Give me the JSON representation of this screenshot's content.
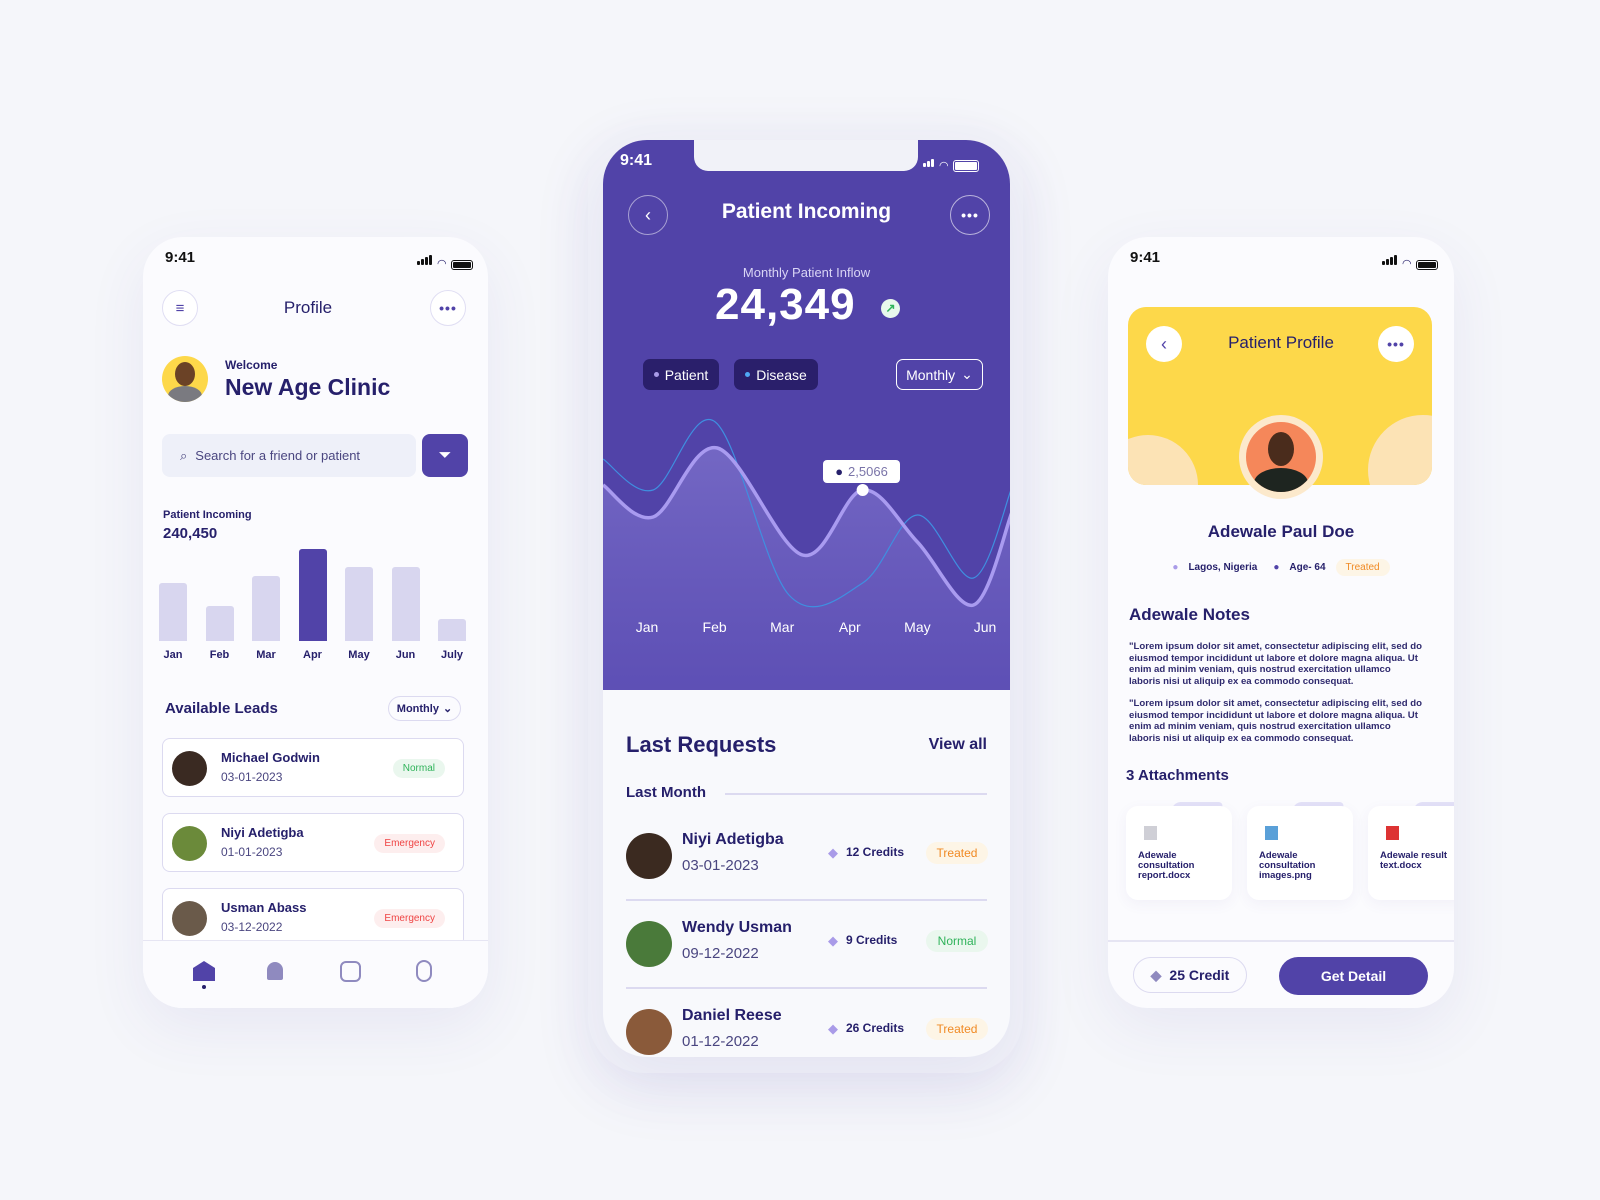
{
  "status_time": "9:41",
  "left": {
    "title": "Profile",
    "welcome": "Welcome",
    "clinic": "New Age Clinic",
    "search_placeholder": "Search for a friend or patient",
    "incoming_label": "Patient Incoming",
    "incoming_value": "240,450",
    "leads_title": "Available Leads",
    "leads_filter": "Monthly",
    "leads": [
      {
        "name": "Michael Godwin",
        "date": "03-01-2023",
        "status": "Normal"
      },
      {
        "name": "Niyi Adetigba",
        "date": "01-01-2023",
        "status": "Emergency"
      },
      {
        "name": "Usman Abass",
        "date": "03-12-2022",
        "status": "Emergency"
      }
    ],
    "nav": [
      "home-icon",
      "bell-icon",
      "sliders-icon",
      "user-icon"
    ]
  },
  "center": {
    "title": "Patient Incoming",
    "inflow_label": "Monthly Patient Inflow",
    "inflow_value": "24,349",
    "chip_patient": "Patient",
    "chip_disease": "Disease",
    "period": "Monthly",
    "tooltip": "2,5066",
    "requests_title": "Last Requests",
    "view_all": "View all",
    "group": "Last Month",
    "requests": [
      {
        "name": "Niyi Adetigba",
        "date": "03-01-2023",
        "credits": "12 Credits",
        "status": "Treated"
      },
      {
        "name": "Wendy Usman",
        "date": "09-12-2022",
        "credits": "9 Credits",
        "status": "Normal"
      },
      {
        "name": "Daniel Reese",
        "date": "01-12-2022",
        "credits": "26 Credits",
        "status": "Treated"
      }
    ]
  },
  "right": {
    "title": "Patient Profile",
    "name": "Adewale Paul Doe",
    "location": "Lagos, Nigeria",
    "age": "Age- 64",
    "status": "Treated",
    "notes_title": "Adewale Notes",
    "notes": [
      "\"Lorem ipsum dolor sit amet, consectetur adipiscing elit, sed do eiusmod tempor incididunt ut labore et dolore magna aliqua. Ut enim ad minim veniam, quis nostrud exercitation ullamco laboris nisi ut aliquip ex ea commodo consequat.",
      "\"Lorem ipsum dolor sit amet, consectetur adipiscing elit, sed do eiusmod tempor incididunt ut labore et dolore magna aliqua. Ut enim ad minim veniam, quis nostrud exercitation ullamco laboris nisi ut aliquip ex ea commodo consequat."
    ],
    "attachments_title": "3 Attachments",
    "attachments": [
      "Adewale consultation report.docx",
      "Adewale consultation images.png",
      "Adewale result text.docx"
    ],
    "credit": "25 Credit",
    "cta": "Get Detail"
  },
  "colors": {
    "primary": "#5143a8",
    "navy": "#26206b",
    "yellow": "#fdd84a",
    "chip": "#2a1f6b"
  },
  "chart_data": [
    {
      "type": "bar",
      "title": "Patient Incoming",
      "categories": [
        "Jan",
        "Feb",
        "Mar",
        "Apr",
        "May",
        "Jun",
        "July"
      ],
      "values": [
        63,
        38,
        71,
        100,
        80,
        80,
        24
      ],
      "highlight": "Apr",
      "grid": false
    },
    {
      "type": "area",
      "categories": [
        "Jan",
        "Feb",
        "Mar",
        "Apr",
        "May",
        "Jun"
      ],
      "grid": false,
      "series": [
        {
          "name": "Patient",
          "x": [
            -0.65,
            0.09,
            1.04,
            2.3,
            3.19,
            4.0,
            4.83,
            5.4
          ],
          "values": [
            135,
            103,
            172,
            65,
            130,
            78,
            15,
            108
          ]
        },
        {
          "name": "Disease",
          "x": [
            -0.65,
            0.09,
            1.01,
            2.1,
            3.19,
            4.0,
            4.83,
            5.4
          ],
          "values": [
            161,
            130,
            198,
            25,
            37,
            105,
            42,
            133
          ]
        }
      ]
    }
  ]
}
